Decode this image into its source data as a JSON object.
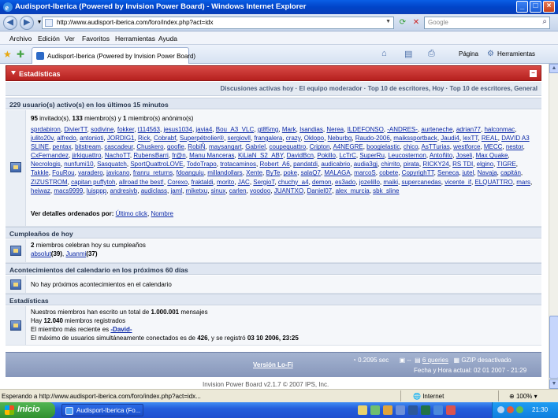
{
  "window": {
    "title": "Audisport-Iberica (Powered by Invision Power Board) - Windows Internet Explorer",
    "minimize": "_",
    "maximize": "□",
    "close": "×"
  },
  "address": {
    "url": "http://www.audisport-iberica.com/foro/index.php?act=idx",
    "search_placeholder": "Google"
  },
  "menu": [
    "Archivo",
    "Edición",
    "Ver",
    "Favoritos",
    "Herramientas",
    "Ayuda"
  ],
  "toolbar": {
    "tab_title": "Audisport-Iberica (Powered by Invision Power Board)",
    "page_label": "Página",
    "tools_label": "Herramientas"
  },
  "forum": {
    "section_title": "Estadísticas",
    "subnav": "Discusiones activas hoy · El equipo moderador · Top 10 de escritores, Hoy · Top 10 de escritores, General",
    "active_header": "229 usuario(s) activo(s) en los últimos 15 minutos",
    "active_summary": {
      "guests": "95",
      "guests_label": "invitado(s),",
      "members": "133",
      "members_label": "miembro(s) y",
      "anon": "1",
      "anon_label": "miembro(s) anónimo(s)"
    },
    "users": [
      "sprdabiron",
      "DivierTT",
      "sodivine",
      "fokker",
      "t114563",
      "jesus1034",
      "javia4",
      "Bou_A3_VLC",
      "gt85mg",
      "Mark",
      "Isandias",
      "Nerea",
      "ILDEFONSO",
      "-ANDRES-",
      "aurteneche",
      "adrian77",
      "halconmac",
      "julito20v",
      "alfredo",
      "antonioti",
      "JORDIG1",
      "Rick",
      "Cobrabf",
      "Superpétrolier®",
      "sergiovll",
      "frangalera",
      "crazy",
      "Oklopo",
      "Neburbg",
      "Raudo-2006",
      "maikssportback",
      "Jaudi4",
      "lexTT",
      "REAL",
      "DAVID A3 SLINE",
      "pentax",
      "bitstream",
      "cascadeur",
      "Chuskero",
      "goofie",
      "RobiÑ",
      "maysangart",
      "Gabriel",
      "coupequattro",
      "Cripton",
      "A4NEGRE",
      "boogielastic",
      "chico",
      "AsTTurias",
      "westforce",
      "MECC",
      "nestor",
      "CxFernandez",
      "jirkiquattro",
      "NachoTT",
      "RubensBarri",
      "fr@n",
      "Manu Manceras",
      "KiLiaN_S2_ABY",
      "DavidBcn",
      "Pokillo",
      "LcTrC",
      "SuperRu",
      "Leucosternon",
      "Antoñito",
      "Joseli",
      "Max Quake",
      "Necrologis",
      "nunfumi10",
      "Sasquatch",
      "SportQuattroLOVE",
      "TodoTrapo",
      "trotacaminos",
      "Robert_A6",
      "pandatdi",
      "audicabrio",
      "audia3gj",
      "chirrito",
      "pirata",
      "RICKY24",
      "RS TDI",
      "elgino",
      "TIGRE",
      "Takkle",
      "FouRou",
      "varadero",
      "javicano",
      "franru_returns",
      "fdoanguiu",
      "millandollars",
      "Xente",
      "ByTe",
      "poke",
      "salaQ7",
      "MALAGA",
      "marcoS",
      "cobete",
      "CopyrighTT",
      "Seneca",
      "jutel",
      "Navaja",
      "capitán",
      "ZIZUSTROM",
      "capitan puffytoh",
      "allroad the best!",
      "Corexo",
      "fraktaldi",
      "morito",
      "JAC",
      "SergioT",
      "chuchy_a4",
      "demon",
      "es3ado",
      "jozelillo",
      "maiki",
      "supercanedas",
      "vicente_if",
      "ELQUATTRO",
      "mars",
      "heiwaz",
      "macs9999",
      "luisppp",
      "andresivb",
      "audiclass",
      "jaml",
      "miketxu",
      "sinux",
      "carlen",
      "voodoo",
      "JUANTXO",
      "Daniel07",
      "alex_murcia",
      "sbk_sline"
    ],
    "sort_label": "Ver detalles ordenados por:",
    "sort_last": "Último click",
    "sort_sep": ",",
    "sort_name": "Nombre",
    "birthday_header": "Cumpleaños de hoy",
    "birthday_count": "2",
    "birthday_text": "miembros celebran hoy su cumpleaños",
    "birthday_user1": "absolut",
    "birthday_age1": "(39)",
    "birthday_user2": "Juanmi",
    "birthday_age2": "(37)",
    "calendar_header": "Acontecimientos del calendario en los próximos 60 días",
    "calendar_text": "No hay próximos acontecimientos en el calendario",
    "stats_header": "Estadísticas",
    "stats_line1_pre": "Nuestros miembros han escrito un total de",
    "stats_posts": "1.000.001",
    "stats_line1_post": "mensajes",
    "stats_line2_pre": "Hay",
    "stats_members": "12.040",
    "stats_line2_post": "miembros registrados",
    "stats_line3_pre": "El miembro más reciente es",
    "stats_newest": "-David-",
    "stats_line4_pre": "El máximo de usuarios simultáneamente conectados es de",
    "stats_max": "426",
    "stats_line4_mid": ", y se registró",
    "stats_date": "03 10 2006, 23:25",
    "version": "Versión Lo-Fi",
    "time_stat": "0.2095 sec",
    "queries": "6 queries",
    "gzip": "GZIP desactivado",
    "datetime": "Fecha y Hora actual: 02 01 2007 - 21:29",
    "credit": "Invision Power Board v2.1.7 © 2007  IPS, Inc."
  },
  "status": {
    "text": "Esperando a http://www.audisport-iberica.com/foro/index.php?act=idx...",
    "zone": "Internet",
    "zoom": "100%"
  },
  "taskbar": {
    "start": "Inicio",
    "item": "Audisport-Iberica (Fo...",
    "clock": "21:30"
  }
}
